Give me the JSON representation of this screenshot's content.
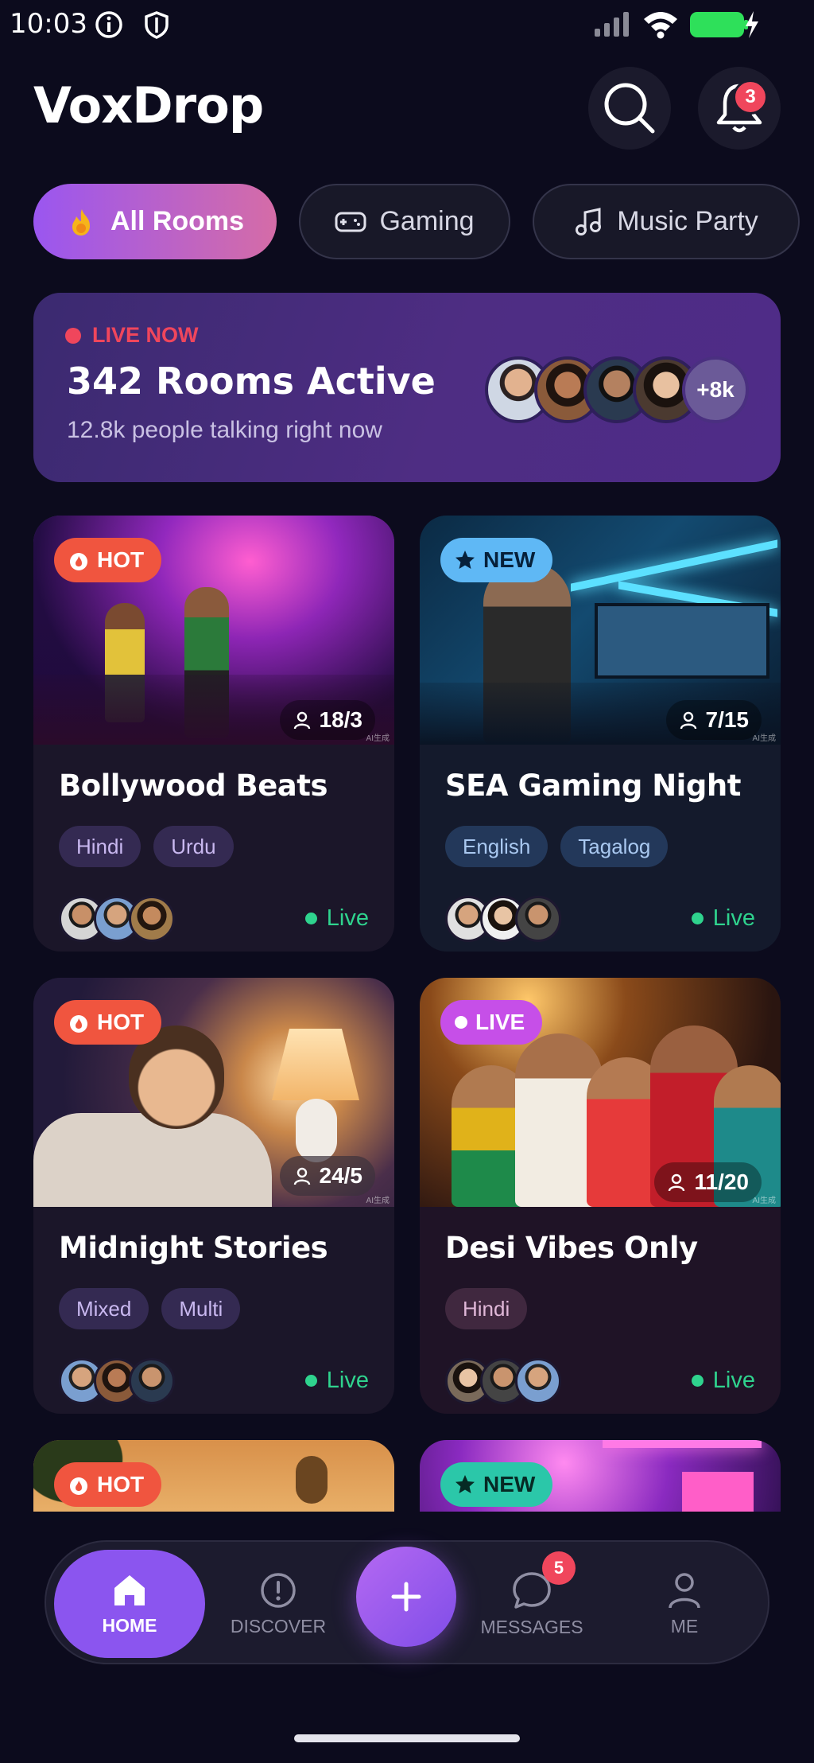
{
  "status": {
    "time": "10:03"
  },
  "header": {
    "title": "VoxDrop",
    "notification_count": "3"
  },
  "categories": [
    {
      "label": "All Rooms",
      "icon": "flame-icon"
    },
    {
      "label": "Gaming",
      "icon": "gamepad-icon"
    },
    {
      "label": "Music Party",
      "icon": "music-note-icon"
    }
  ],
  "banner": {
    "live_label": "LIVE NOW",
    "title": "342 Rooms Active",
    "subtitle": "12.8k people talking right now",
    "more_count": "+8k"
  },
  "rooms": [
    {
      "badge": "HOT",
      "count": "18/3",
      "name": "Bollywood Beats",
      "tags": [
        "Hindi",
        "Urdu"
      ],
      "status": "Live",
      "watermark": "AI生成"
    },
    {
      "badge": "NEW",
      "count": "7/15",
      "name": "SEA Gaming Night",
      "tags": [
        "English",
        "Tagalog"
      ],
      "status": "Live",
      "watermark": "AI生成"
    },
    {
      "badge": "HOT",
      "count": "24/5",
      "name": "Midnight Stories",
      "tags": [
        "Mixed",
        "Multi"
      ],
      "status": "Live",
      "watermark": "AI生成"
    },
    {
      "badge": "LIVE",
      "count": "11/20",
      "name": "Desi Vibes Only",
      "tags": [
        "Hindi"
      ],
      "status": "Live",
      "watermark": "AI生成"
    },
    {
      "badge": "HOT"
    },
    {
      "badge": "NEW"
    }
  ],
  "nav": {
    "home": "HOME",
    "discover": "DISCOVER",
    "messages": "MESSAGES",
    "messages_badge": "5",
    "me": "ME"
  },
  "colors": {
    "accent": "#8b55ef",
    "hot": "#f0553f",
    "live_green": "#2fd38e",
    "badge_red": "#f0465c"
  }
}
